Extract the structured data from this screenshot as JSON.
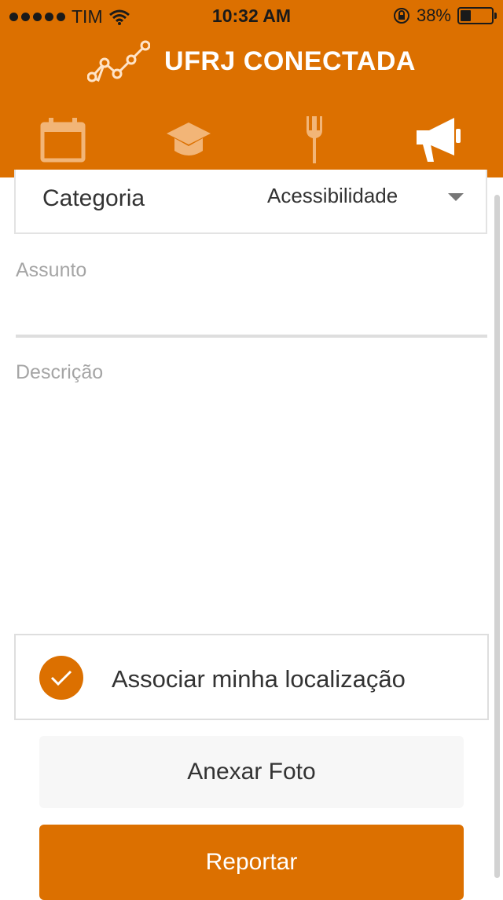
{
  "status_bar": {
    "carrier": "TIM",
    "time": "10:32 AM",
    "battery_percent": "38%",
    "battery_level": 0.38,
    "icons": [
      "signal-dots-icon",
      "wifi-icon",
      "rotation-lock-icon",
      "battery-icon"
    ]
  },
  "header": {
    "title": "UFRJ CONECTADA",
    "logo_icon": "connected-dots-logo",
    "background_color": "#dc7000"
  },
  "tabs": [
    {
      "icon": "calendar-icon",
      "active": false
    },
    {
      "icon": "graduation-cap-icon",
      "active": false
    },
    {
      "icon": "fork-icon",
      "active": false
    },
    {
      "icon": "megaphone-icon",
      "active": true
    }
  ],
  "form": {
    "category_label": "Categoria",
    "category_value": "Acessibilidade",
    "subject_placeholder": "Assunto",
    "description_placeholder": "Descrição",
    "location_label": "Associar minha localização",
    "location_checked": true
  },
  "buttons": {
    "attach_photo": "Anexar Foto",
    "report": "Reportar"
  },
  "colors": {
    "accent": "#dc7000",
    "placeholder": "#a5a5a5",
    "text": "#333333"
  }
}
